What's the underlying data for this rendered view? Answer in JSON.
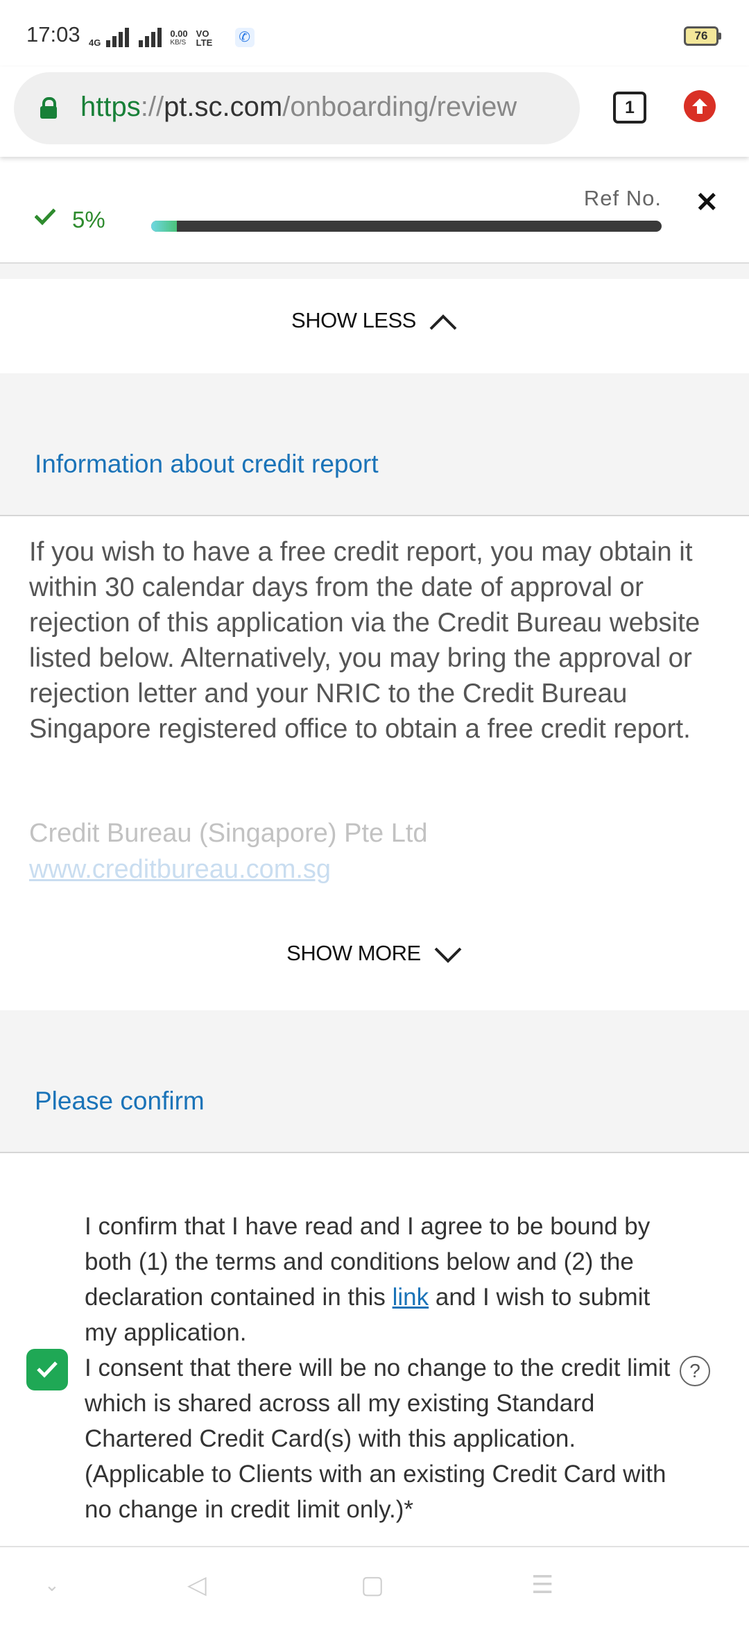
{
  "status_bar": {
    "time": "17:03",
    "network_type": "4G",
    "data_speed": "0.00",
    "data_unit": "KB/S",
    "volte": "VO LTE",
    "battery": "76"
  },
  "browser": {
    "url_scheme": "https",
    "url_separator": "://",
    "url_host": "pt.sc.com",
    "url_path": "/onboarding/review",
    "tab_count": "1"
  },
  "progress": {
    "percent_label": "5%",
    "fraction": 0.05,
    "ref_label": "Ref No."
  },
  "show_less_label": "SHOW LESS",
  "credit_report": {
    "title": "Information about credit report",
    "body": "If you wish to have a free credit report, you may obtain it within 30 calendar days from the date of approval or rejection of this application via the Credit Bureau website listed below. Alternatively, you may bring the approval or rejection letter and your NRIC to the Credit Bureau Singapore registered office to obtain a free credit report.",
    "bureau_name": "Credit Bureau (Singapore) Pte Ltd",
    "bureau_link": "www.creditbureau.com.sg",
    "show_more_label": "SHOW MORE"
  },
  "confirm": {
    "title": "Please confirm",
    "text_part1": "I confirm that I have read and I agree to be bound by both (1) the terms and conditions below and (2) the declaration contained in this ",
    "link_text": "link",
    "text_part2": " and I wish to submit my application.",
    "text_part3": "I consent that there will be no change to the credit limit which is shared across all my existing Standard Chartered Credit Card(s) with this application. (Applicable to Clients with an existing Credit Card with no change in credit limit only.)*",
    "checked": true,
    "help_symbol": "?"
  },
  "colors": {
    "accent_blue": "#1a73b8",
    "check_green": "#1fa855",
    "progress_green": "#2e8b2e",
    "update_red": "#d93025"
  }
}
